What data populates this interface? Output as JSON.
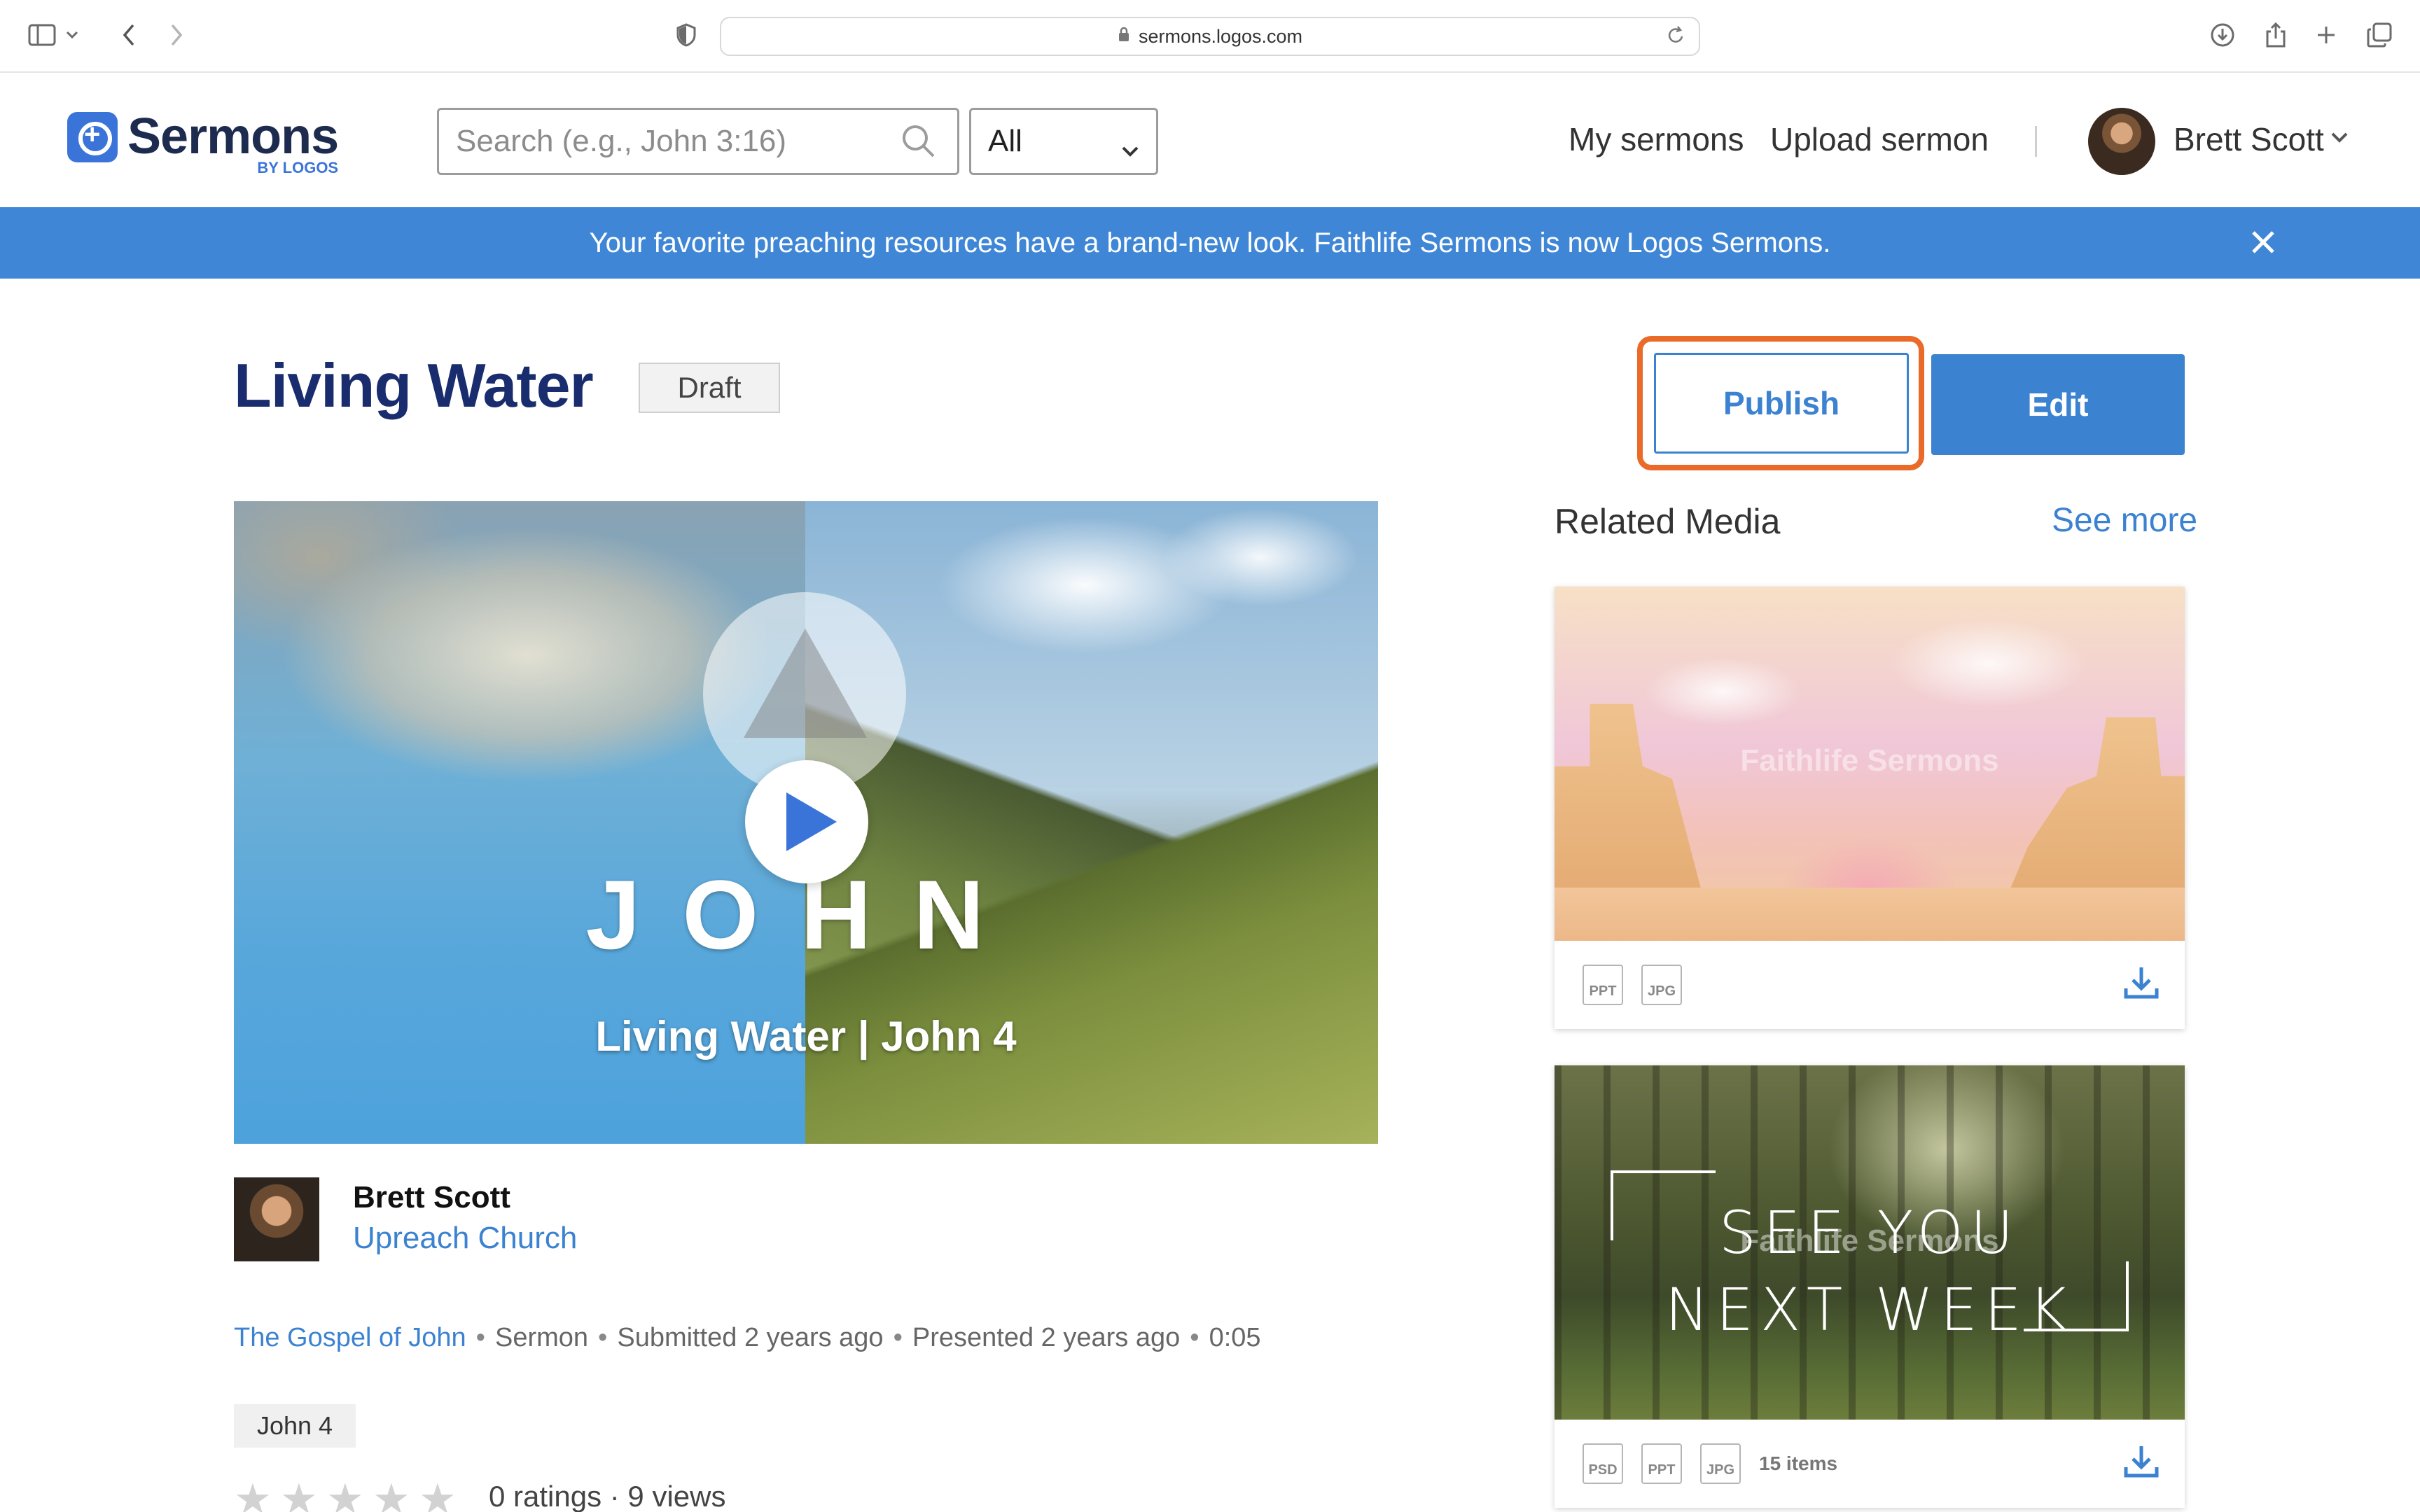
{
  "browser": {
    "url": "sermons.logos.com"
  },
  "header": {
    "logo_title": "Sermons",
    "logo_sub": "BY LOGOS",
    "search_placeholder": "Search (e.g., John 3:16)",
    "scope_value": "All",
    "nav_my_sermons": "My sermons",
    "nav_upload": "Upload sermon",
    "user_name": "Brett Scott"
  },
  "banner": {
    "text": "Your favorite preaching resources have a brand-new look. Faithlife Sermons is now Logos Sermons."
  },
  "sermon": {
    "title": "Living Water",
    "status": "Draft",
    "publish_label": "Publish",
    "edit_label": "Edit",
    "video_word": "JOHN",
    "video_caption": "Living Water | John 4",
    "author_name": "Brett Scott",
    "church": "Upreach Church",
    "series": "The Gospel of John",
    "type": "Sermon",
    "submitted": "Submitted 2 years ago",
    "presented": "Presented 2 years ago",
    "duration": "0:05",
    "tag": "John 4",
    "ratings_text": "0 ratings · 9 views"
  },
  "related": {
    "title": "Related Media",
    "see_more": "See more",
    "cards": [
      {
        "watermark": "Faithlife Sermons",
        "files": [
          "PPT",
          "JPG"
        ],
        "items": ""
      },
      {
        "watermark": "Faithlife Sermons",
        "line1": "SEE YOU",
        "line2": "NEXT WEEK",
        "files": [
          "PSD",
          "PPT",
          "JPG"
        ],
        "items": "15 items"
      }
    ]
  },
  "colors": {
    "brand_blue": "#3b82d0",
    "banner_blue": "#3f87d6",
    "title_navy": "#182c6e",
    "highlight_orange": "#ea6a2a"
  }
}
